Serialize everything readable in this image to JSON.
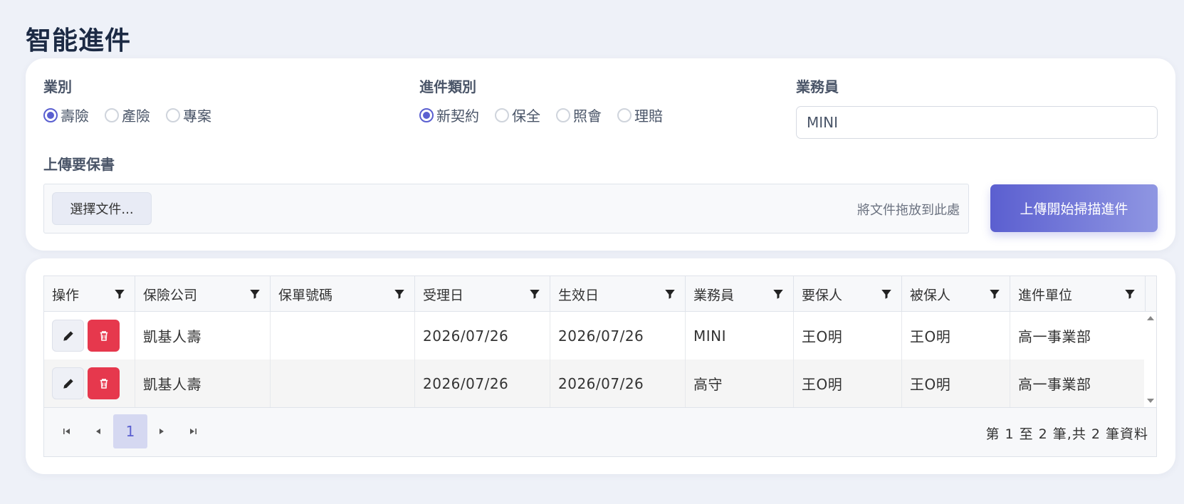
{
  "page": {
    "title": "智能進件"
  },
  "form": {
    "business_type": {
      "label": "業別",
      "options": [
        {
          "label": "壽險",
          "checked": true
        },
        {
          "label": "產險",
          "checked": false
        },
        {
          "label": "專案",
          "checked": false
        }
      ]
    },
    "case_type": {
      "label": "進件類別",
      "options": [
        {
          "label": "新契約",
          "checked": true
        },
        {
          "label": "保全",
          "checked": false
        },
        {
          "label": "照會",
          "checked": false
        },
        {
          "label": "理賠",
          "checked": false
        }
      ]
    },
    "agent": {
      "label": "業務員",
      "value": "MINI"
    },
    "upload": {
      "label": "上傳要保書",
      "choose_label": "選擇文件...",
      "drop_hint": "將文件拖放到此處",
      "submit_label": "上傳開始掃描進件"
    }
  },
  "table": {
    "columns": [
      "操作",
      "保險公司",
      "保單號碼",
      "受理日",
      "生效日",
      "業務員",
      "要保人",
      "被保人",
      "進件單位"
    ],
    "rows": [
      {
        "company": "凱基人壽",
        "policy_no": "",
        "accept_date": "2026/07/26",
        "effective_date": "2026/07/26",
        "agent": "MINI",
        "applicant": "王O明",
        "insured": "王O明",
        "unit": "高一事業部"
      },
      {
        "company": "凱基人壽",
        "policy_no": "",
        "accept_date": "2026/07/26",
        "effective_date": "2026/07/26",
        "agent": "高守",
        "applicant": "王O明",
        "insured": "王O明",
        "unit": "高一事業部"
      }
    ],
    "paginator": {
      "current_page": "1",
      "report": "第 1 至 2 筆,共 2 筆資料"
    }
  },
  "colors": {
    "accent": "#5a5fd0",
    "danger": "#e6384d",
    "background": "#eef1f8"
  },
  "icons": {
    "edit": "pencil-icon",
    "delete": "trash-icon",
    "filter": "filter-icon"
  }
}
